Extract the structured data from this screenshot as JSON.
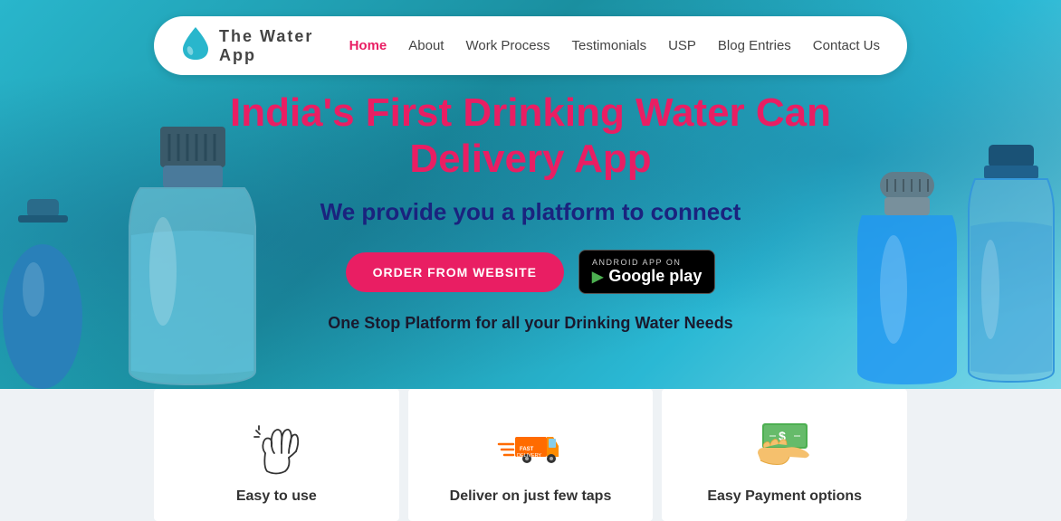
{
  "app": {
    "name": "The Water App",
    "logo_char": "💧"
  },
  "nav": {
    "links": [
      {
        "label": "Home",
        "active": true
      },
      {
        "label": "About",
        "active": false
      },
      {
        "label": "Work Process",
        "active": false
      },
      {
        "label": "Testimonials",
        "active": false
      },
      {
        "label": "USP",
        "active": false
      },
      {
        "label": "Blog Entries",
        "active": false
      },
      {
        "label": "Contact Us",
        "active": false
      }
    ]
  },
  "hero": {
    "title": "India's First Drinking Water Can\nDelivery App",
    "subtitle": "We provide you a platform to connect",
    "cta_order": "ORDER FROM WEBSITE",
    "cta_gplay_top": "ANDROID APP ON",
    "cta_gplay_bottom": "Google play",
    "tagline": "One Stop Platform for all your Drinking Water Needs"
  },
  "cards": [
    {
      "id": "easy-to-use",
      "label": "Easy to use",
      "icon": "hand"
    },
    {
      "id": "deliver-on-taps",
      "label": "Deliver on just few taps",
      "icon": "delivery"
    },
    {
      "id": "easy-payment",
      "label": "Easy Payment options",
      "icon": "payment"
    }
  ],
  "colors": {
    "accent_pink": "#e91e63",
    "accent_blue": "#1a237e",
    "hero_bg": "#29b6cc"
  }
}
